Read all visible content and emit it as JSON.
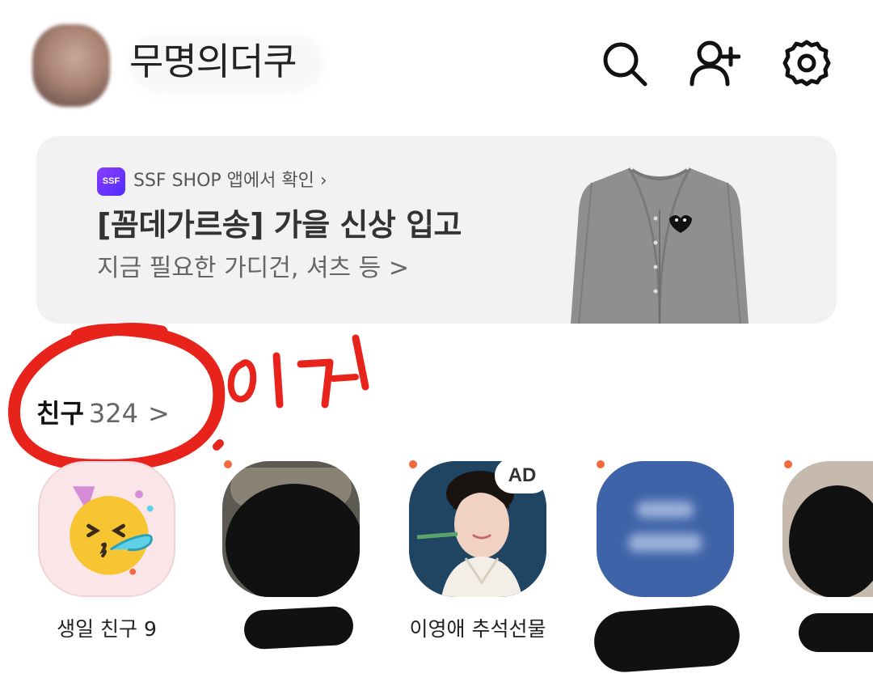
{
  "header": {
    "nickname": "무명의더쿠",
    "icons": [
      "search-icon",
      "add-friend-icon",
      "settings-icon"
    ]
  },
  "banner": {
    "logo_text": "SSF",
    "source": "SSF SHOP 앱에서 확인 ›",
    "title": "[꼼데가르송] 가을 신상 입고",
    "subtitle": "지금 필요한 가디건, 셔츠 등 >"
  },
  "friends": {
    "label": "친구",
    "count": "324",
    "chevron": ">",
    "annotation": "이거",
    "items": [
      {
        "name": "생일 친구 9"
      },
      {
        "name": ""
      },
      {
        "name": "이영애 추석선물",
        "badge": "AD"
      },
      {
        "name": ""
      },
      {
        "name": ""
      }
    ]
  },
  "colors": {
    "annotation_red": "#e8231c",
    "new_dot": "#f06a3c",
    "banner_bg": "#f2f2f2"
  }
}
